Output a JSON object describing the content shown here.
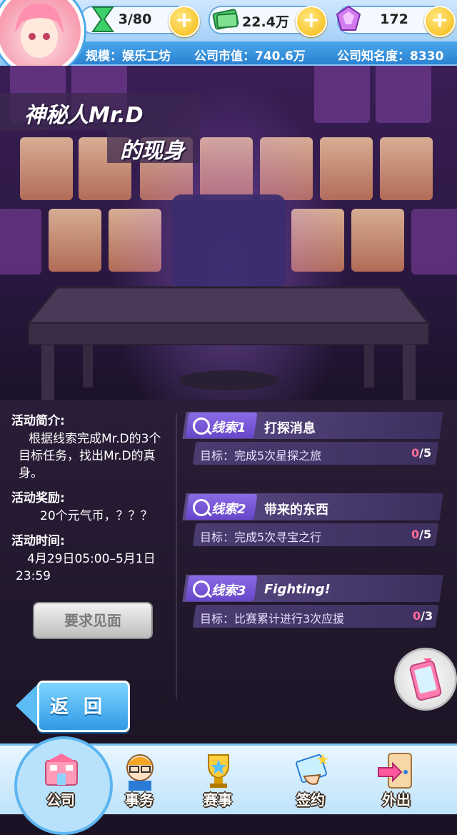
{
  "topbar": {
    "energy": {
      "value": "3/80",
      "icon": "hourglass-icon"
    },
    "money": {
      "value": "22.4万",
      "icon": "cash-icon"
    },
    "gems": {
      "value": "172",
      "icon": "diamond-icon"
    },
    "plus": "+",
    "scale_label": "规模：娱乐工坊",
    "market_value_label": "公司市值：740.6万",
    "fame_label": "公司知名度：8330"
  },
  "event": {
    "title_line1": "神秘人Mr.D",
    "title_line2": "的现身",
    "intro_label": "活动简介:",
    "intro_text_1": "根据线索完成Mr.D的3个",
    "intro_text_2": "目标任务，找出Mr.D的真",
    "intro_text_3": "身。",
    "reward_label": "活动奖励:",
    "reward_text": "20个元气币，？？？",
    "time_label": "活动时间:",
    "time_text_1": "4月29日05:00–5月1日",
    "time_text_2": "23:59",
    "request_button": "要求见面",
    "back_button": "返 回"
  },
  "clues": [
    {
      "tag": "线索1",
      "title": "打探消息",
      "goal": "目标：完成5次星探之旅",
      "current": "0",
      "total": "/5"
    },
    {
      "tag": "线索2",
      "title": "带来的东西",
      "goal": "目标：完成5次寻宝之行",
      "current": "0",
      "total": "/5"
    },
    {
      "tag": "线索3",
      "title": "Fighting!",
      "goal": "目标：比赛累计进行3次应援",
      "current": "0",
      "total": "/3"
    }
  ],
  "nav": [
    {
      "label": "公司",
      "icon": "company-building-icon",
      "active": true
    },
    {
      "label": "事务",
      "icon": "assistant-icon",
      "active": false
    },
    {
      "label": "赛事",
      "icon": "trophy-icon",
      "active": false
    },
    {
      "label": "签约",
      "icon": "contract-icon",
      "active": false
    },
    {
      "label": "外出",
      "icon": "door-exit-icon",
      "active": false
    }
  ],
  "colors": {
    "accent": "#4aa6ea",
    "clue_tag": "#7a5ad9",
    "progress_current": "#ff6a9a"
  }
}
